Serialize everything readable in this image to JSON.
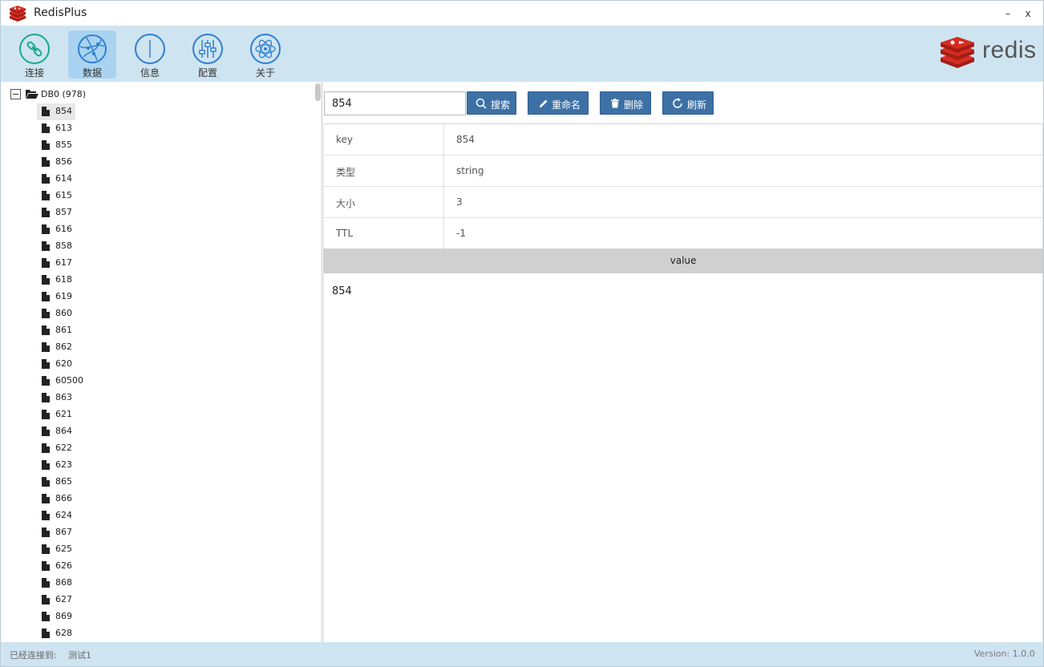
{
  "window": {
    "title": "RedisPlus",
    "minimize_label": "–",
    "close_label": "x"
  },
  "toolbar": {
    "items": [
      {
        "label": "连接",
        "icon": "link-icon",
        "active": false
      },
      {
        "label": "数据",
        "icon": "globe-icon",
        "active": true
      },
      {
        "label": "信息",
        "icon": "info-icon",
        "active": false
      },
      {
        "label": "配置",
        "icon": "sliders-icon",
        "active": false
      },
      {
        "label": "关于",
        "icon": "atom-icon",
        "active": false
      }
    ],
    "logo_text": "redis"
  },
  "tree": {
    "root_label": "DB0 (978)",
    "items": [
      "854",
      "613",
      "855",
      "856",
      "614",
      "615",
      "857",
      "616",
      "858",
      "617",
      "618",
      "619",
      "860",
      "861",
      "862",
      "620",
      "60500",
      "863",
      "621",
      "864",
      "622",
      "623",
      "865",
      "866",
      "624",
      "867",
      "625",
      "626",
      "868",
      "627",
      "869",
      "628"
    ],
    "selected": "854"
  },
  "search": {
    "value": "854",
    "search_label": "搜索",
    "rename_label": "重命名",
    "delete_label": "删除",
    "refresh_label": "刷新"
  },
  "details": {
    "rows": [
      {
        "key": "key",
        "value": "854"
      },
      {
        "key": "类型",
        "value": "string"
      },
      {
        "key": "大小",
        "value": "3"
      },
      {
        "key": "TTL",
        "value": "-1"
      }
    ],
    "value_header": "value",
    "value_text": "854"
  },
  "status": {
    "connected_label": "已经连接到:",
    "connection_name": "测试1",
    "version": "Version: 1.0.0"
  },
  "colors": {
    "toolbar_bg": "#cfe4f1",
    "active_tool_bg": "#a9d3f0",
    "button_bg": "#3d71a6",
    "icon_teal": "#1aa88c",
    "icon_blue": "#2f7fd1",
    "redis_red": "#d82c20"
  }
}
